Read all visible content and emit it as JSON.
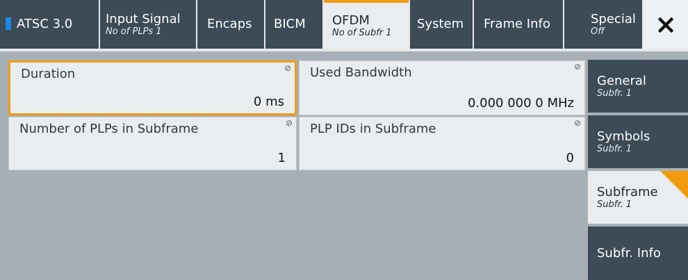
{
  "colors": {
    "accent": "#f39c12",
    "tab_dark": "#3c4b56",
    "panel_light": "#e9edf0",
    "status_blue": "#1e88e5"
  },
  "tabs": [
    {
      "label": "ATSC 3.0",
      "sub": ""
    },
    {
      "label": "Input Signal",
      "sub": "No of PLPs 1"
    },
    {
      "label": "Encaps",
      "sub": ""
    },
    {
      "label": "BICM",
      "sub": ""
    },
    {
      "label": "OFDM",
      "sub": "No of Subfr 1",
      "active": true
    },
    {
      "label": "System",
      "sub": ""
    },
    {
      "label": "Frame Info",
      "sub": ""
    },
    {
      "label": "Special",
      "sub": "Off"
    }
  ],
  "close_icon": "×",
  "fields": {
    "duration": {
      "label": "Duration",
      "value": "0 ms"
    },
    "used_bandwidth": {
      "label": "Used Bandwidth",
      "value": "0.000 000 0 MHz"
    },
    "num_plps": {
      "label": "Number of PLPs in Subframe",
      "value": "1"
    },
    "plp_ids": {
      "label": "PLP IDs in Subframe",
      "value": "0"
    }
  },
  "lock_icon": "⊘",
  "menu": [
    {
      "label": "General",
      "sub": "Subfr. 1"
    },
    {
      "label": "Symbols",
      "sub": "Subfr. 1"
    },
    {
      "label": "Subframe",
      "sub": "Subfr. 1",
      "active": true
    },
    {
      "label": "Subfr. Info",
      "sub": ""
    }
  ]
}
